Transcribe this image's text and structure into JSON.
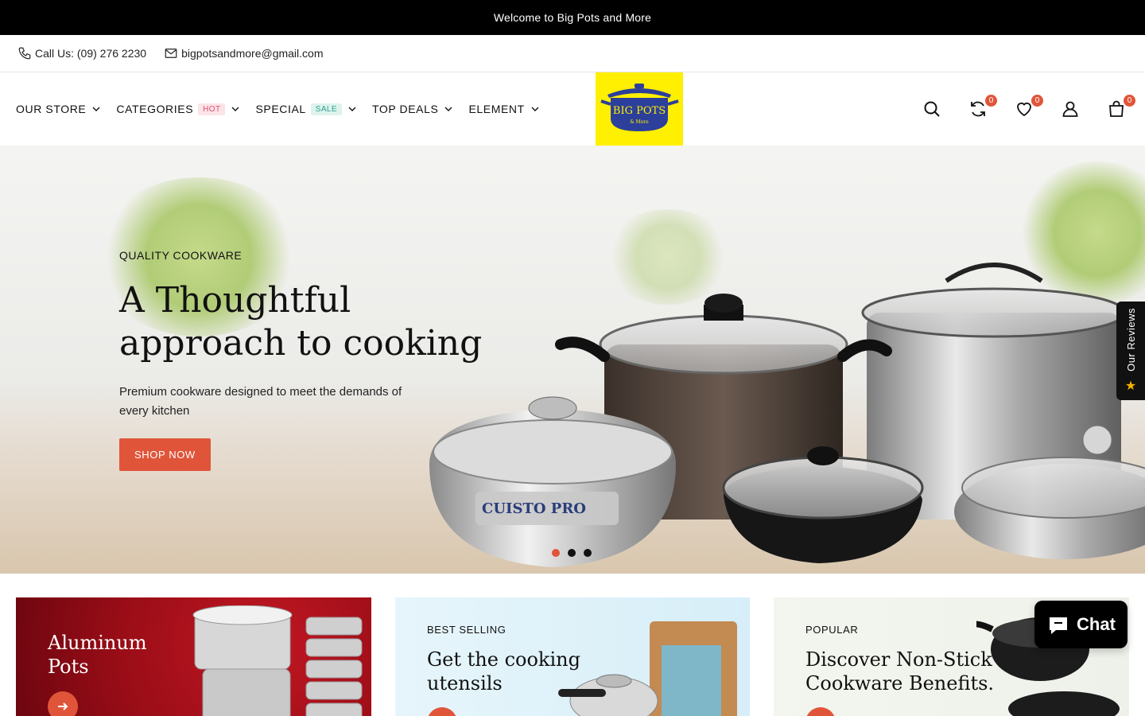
{
  "topbar": {
    "welcome": "Welcome to Big Pots and More"
  },
  "contact": {
    "phone": "Call Us: (09) 276 2230",
    "email": "bigpotsandmore@gmail.com"
  },
  "nav": {
    "items": [
      {
        "label": "OUR STORE"
      },
      {
        "label": "CATEGORIES",
        "badge": "HOT"
      },
      {
        "label": "SPECIAL",
        "badge": "SALE"
      },
      {
        "label": "TOP DEALS"
      },
      {
        "label": "ELEMENT"
      }
    ]
  },
  "logo": {
    "text": "BIG POTS",
    "subtext": "& More"
  },
  "header_icons": {
    "compare_count": "0",
    "wishlist_count": "0",
    "cart_count": "0"
  },
  "hero": {
    "eyebrow": "QUALITY COOKWARE",
    "title_line1": "A Thoughtful",
    "title_line2": "approach to cooking",
    "subtitle": "Premium cookware designed to meet the demands of every kitchen",
    "button": "SHOP NOW",
    "product_label": "CUISTO PRO"
  },
  "reviews_tab": {
    "label": "Our Reviews"
  },
  "cards": [
    {
      "eyebrow": "",
      "title": "Aluminum Pots"
    },
    {
      "eyebrow": "BEST SELLING",
      "title": "Get the cooking utensils"
    },
    {
      "eyebrow": "POPULAR",
      "title": "Discover Non-Stick Cookware Benefits."
    }
  ],
  "chat": {
    "label": "Chat"
  },
  "colors": {
    "accent": "#e0553a",
    "logo_bg": "#ffef00",
    "logo_blue": "#2c3f9a"
  }
}
